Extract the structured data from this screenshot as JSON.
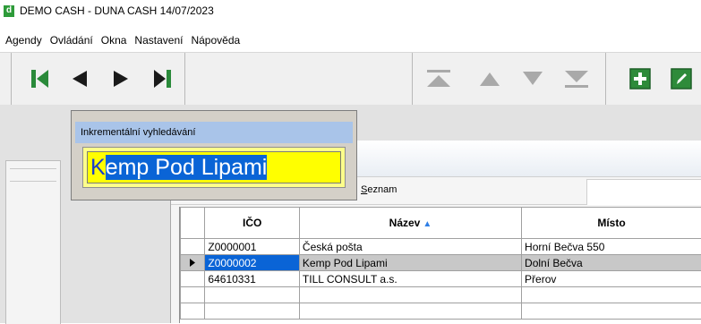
{
  "window": {
    "logo_letter": "d",
    "title": "DEMO CASH - DUNA CASH   14/07/2023"
  },
  "menu": {
    "items": [
      "Agendy",
      "Ovládání",
      "Okna",
      "Nastavení",
      "Nápověda"
    ]
  },
  "toolbar": {
    "nav_icons": [
      "first-record-icon",
      "previous-record-icon",
      "next-record-icon",
      "last-record-icon"
    ],
    "disabled_icons": [
      "move-top-icon",
      "move-up-icon",
      "move-down-icon",
      "move-bottom-icon"
    ],
    "action_icons": [
      "add-record-icon",
      "edit-record-icon"
    ],
    "colors": {
      "nav": "#2a8a3a",
      "disabled": "#a9a9a9",
      "add": "#2e8b3a"
    }
  },
  "search_popup": {
    "title": "Inkrementální vyhledávání",
    "typed": "K",
    "highlighted": "emp Pod Lipami"
  },
  "tabs": {
    "seznam_first": "S",
    "seznam_rest": "eznam"
  },
  "table": {
    "columns": {
      "ico": "IČO",
      "nazev": "Název",
      "misto": "Místo"
    },
    "rows": [
      {
        "ico": "Z0000001",
        "nazev": "Česká pošta",
        "misto": "Horní Bečva 550",
        "selected": false
      },
      {
        "ico": "Z0000002",
        "nazev": "Kemp Pod Lipami",
        "misto": "Dolní Bečva",
        "selected": true
      },
      {
        "ico": "64610331",
        "nazev": "TILL CONSULT a.s.",
        "misto": "Přerov",
        "selected": false
      }
    ],
    "selection_color": "#0a64d6"
  }
}
